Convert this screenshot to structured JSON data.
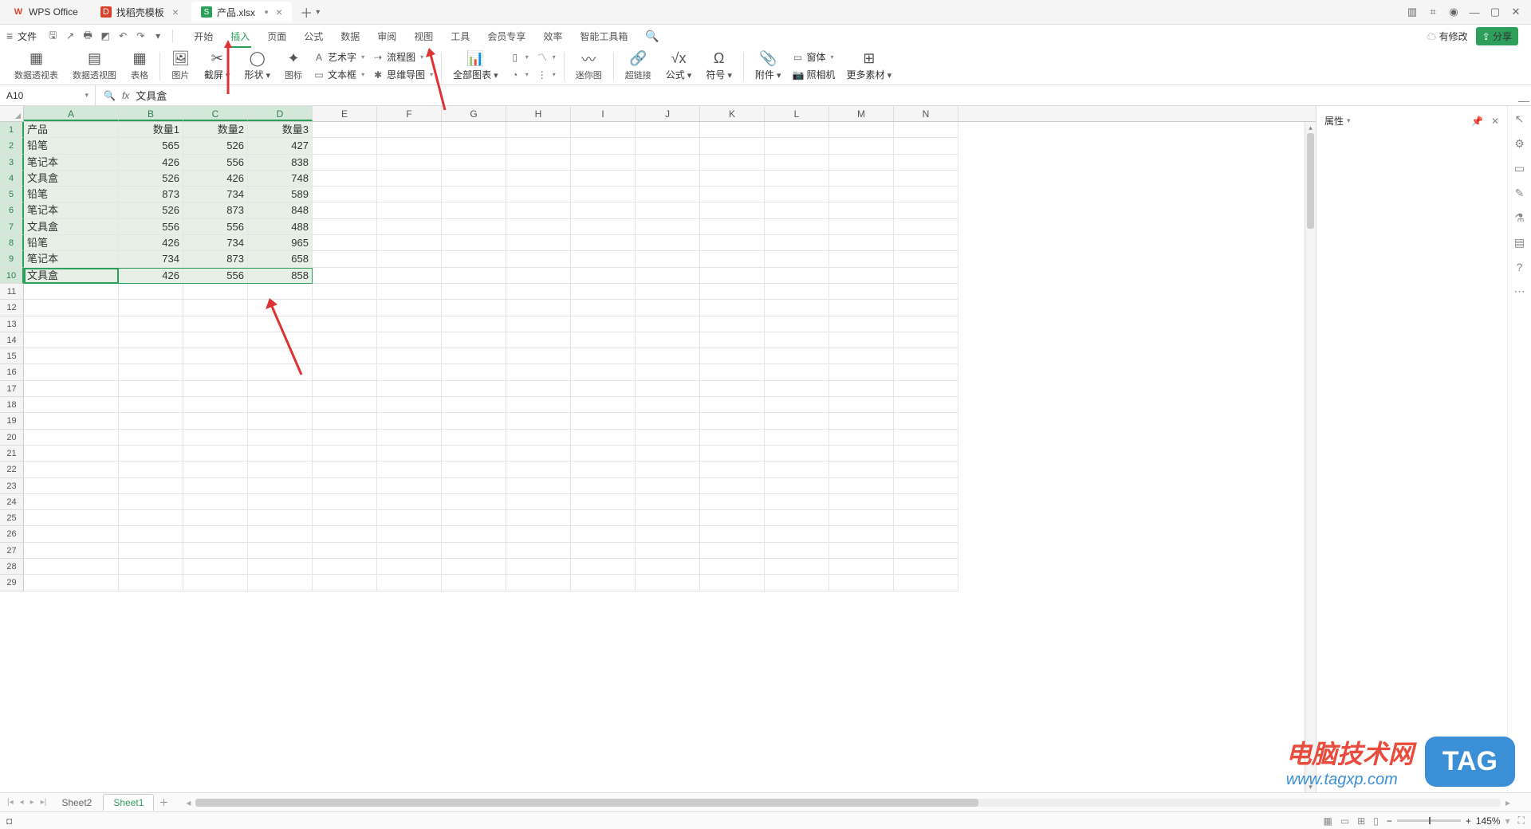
{
  "tabs": {
    "app": "WPS Office",
    "template": "找稻壳模板",
    "file": "产品.xlsx"
  },
  "menu": {
    "file": "文件",
    "items": [
      "开始",
      "插入",
      "页面",
      "公式",
      "数据",
      "审阅",
      "视图",
      "工具",
      "会员专享",
      "效率",
      "智能工具箱"
    ],
    "active_index": 1,
    "cloud": "有修改",
    "share": "分享"
  },
  "ribbon": {
    "g1": "数据透视表",
    "g2": "数据透视图",
    "g3": "表格",
    "g4": "图片",
    "g5": "截屏",
    "g6": "形状",
    "g7": "图标",
    "c1a": "艺术字",
    "c1b": "文本框",
    "c2a": "流程图",
    "c2b": "思维导图",
    "g8": "全部图表",
    "g9": "迷你图",
    "g10": "超链接",
    "g11": "公式",
    "g12": "符号",
    "g13": "附件",
    "g14": "照相机",
    "g15": "更多素材",
    "c3a": "窗体"
  },
  "namebox": "A10",
  "formula": "文具盒",
  "panel": {
    "title": "属性"
  },
  "columns": [
    "A",
    "B",
    "C",
    "D",
    "E",
    "F",
    "G",
    "H",
    "I",
    "J",
    "K",
    "L",
    "M",
    "N"
  ],
  "headers": [
    "产品",
    "数量1",
    "数量2",
    "数量3"
  ],
  "data": [
    [
      "铅笔",
      "565",
      "526",
      "427"
    ],
    [
      "笔记本",
      "426",
      "556",
      "838"
    ],
    [
      "文具盒",
      "526",
      "426",
      "748"
    ],
    [
      "铅笔",
      "873",
      "734",
      "589"
    ],
    [
      "笔记本",
      "526",
      "873",
      "848"
    ],
    [
      "文具盒",
      "556",
      "556",
      "488"
    ],
    [
      "铅笔",
      "426",
      "734",
      "965"
    ],
    [
      "笔记本",
      "734",
      "873",
      "658"
    ],
    [
      "文具盒",
      "426",
      "556",
      "858"
    ]
  ],
  "total_rows": 29,
  "active_cell": "A10",
  "selection": {
    "r": 10,
    "c1": 1,
    "c2": 4
  },
  "sheets": {
    "list": [
      "Sheet2",
      "Sheet1"
    ],
    "active": 1
  },
  "status": {
    "zoom": "145%"
  },
  "watermark": {
    "t1": "电脑技术网",
    "t2": "www.tagxp.com",
    "tag": "TAG"
  }
}
